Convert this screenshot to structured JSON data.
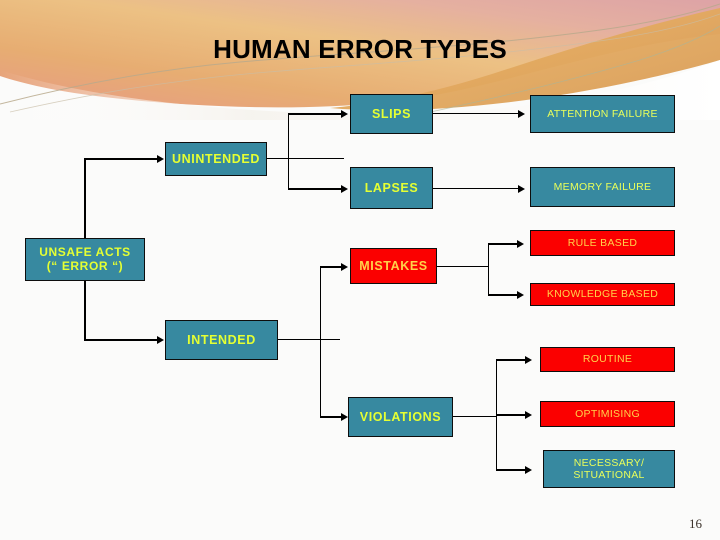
{
  "slide": {
    "title": "HUMAN ERROR TYPES",
    "page_number": "16"
  },
  "colors": {
    "teal": "#3789a0",
    "red": "#fb0000",
    "label_yellow": "#e5ff33",
    "label_amber": "#ffd24a",
    "border": "#0d0d0d",
    "background": "#fbfbfa",
    "title_text": "#000000",
    "banner_peach": "#e8a589",
    "banner_gold": "#e3ab5e",
    "banner_rose": "#dfa79d"
  },
  "nodes": {
    "unsafe_acts": {
      "line1": "UNSAFE ACTS",
      "line2": "(“ ERROR “)"
    },
    "unintended": {
      "label": "UNINTENDED"
    },
    "intended": {
      "label": "INTENDED"
    },
    "slips": {
      "label": "SLIPS"
    },
    "lapses": {
      "label": "LAPSES"
    },
    "mistakes": {
      "label": "MISTAKES"
    },
    "violations": {
      "label": "VIOLATIONS"
    },
    "attention_failure": {
      "label": "ATTENTION FAILURE"
    },
    "memory_failure": {
      "label": "MEMORY FAILURE"
    },
    "rule_based": {
      "label": "RULE BASED"
    },
    "knowledge_based": {
      "label": "KNOWLEDGE BASED"
    },
    "routine": {
      "label": "ROUTINE"
    },
    "optimising": {
      "label": "OPTIMISING"
    },
    "necessary_situational": {
      "line1": "NECESSARY/",
      "line2": "SITUATIONAL"
    }
  },
  "chart_data": {
    "type": "diagram",
    "title": "HUMAN ERROR TYPES",
    "diagram_kind": "hierarchy-tree",
    "root": "UNSAFE ACTS (“ ERROR “)",
    "nodes": [
      {
        "id": "unsafe_acts",
        "label": "UNSAFE ACTS (“ ERROR “)",
        "level": 0,
        "fill": "#3789a0",
        "text": "#e5ff33"
      },
      {
        "id": "unintended",
        "label": "UNINTENDED",
        "level": 1,
        "fill": "#3789a0",
        "text": "#e5ff33"
      },
      {
        "id": "intended",
        "label": "INTENDED",
        "level": 1,
        "fill": "#3789a0",
        "text": "#e5ff33"
      },
      {
        "id": "slips",
        "label": "SLIPS",
        "level": 2,
        "fill": "#3789a0",
        "text": "#e5ff33"
      },
      {
        "id": "lapses",
        "label": "LAPSES",
        "level": 2,
        "fill": "#3789a0",
        "text": "#e5ff33"
      },
      {
        "id": "mistakes",
        "label": "MISTAKES",
        "level": 2,
        "fill": "#fb0000",
        "text": "#ffd24a"
      },
      {
        "id": "violations",
        "label": "VIOLATIONS",
        "level": 2,
        "fill": "#3789a0",
        "text": "#e5ff33"
      },
      {
        "id": "attention_failure",
        "label": "ATTENTION FAILURE",
        "level": 3,
        "fill": "#3789a0",
        "text": "#eaff5a"
      },
      {
        "id": "memory_failure",
        "label": "MEMORY FAILURE",
        "level": 3,
        "fill": "#3789a0",
        "text": "#eaff5a"
      },
      {
        "id": "rule_based",
        "label": "RULE BASED",
        "level": 3,
        "fill": "#fb0000",
        "text": "#ffd24a"
      },
      {
        "id": "knowledge_based",
        "label": "KNOWLEDGE BASED",
        "level": 3,
        "fill": "#fb0000",
        "text": "#ffd24a"
      },
      {
        "id": "routine",
        "label": "ROUTINE",
        "level": 3,
        "fill": "#fb0000",
        "text": "#ffd24a"
      },
      {
        "id": "optimising",
        "label": "OPTIMISING",
        "level": 3,
        "fill": "#fb0000",
        "text": "#ffd24a"
      },
      {
        "id": "necessary_situational",
        "label": "NECESSARY/ SITUATIONAL",
        "level": 3,
        "fill": "#3789a0",
        "text": "#eaff5a"
      }
    ],
    "edges": [
      {
        "from": "unsafe_acts",
        "to": "unintended"
      },
      {
        "from": "unsafe_acts",
        "to": "intended"
      },
      {
        "from": "unintended",
        "to": "slips"
      },
      {
        "from": "unintended",
        "to": "lapses"
      },
      {
        "from": "intended",
        "to": "mistakes"
      },
      {
        "from": "intended",
        "to": "violations"
      },
      {
        "from": "slips",
        "to": "attention_failure"
      },
      {
        "from": "lapses",
        "to": "memory_failure"
      },
      {
        "from": "mistakes",
        "to": "rule_based"
      },
      {
        "from": "mistakes",
        "to": "knowledge_based"
      },
      {
        "from": "violations",
        "to": "routine"
      },
      {
        "from": "violations",
        "to": "optimising"
      },
      {
        "from": "violations",
        "to": "necessary_situational"
      }
    ]
  }
}
